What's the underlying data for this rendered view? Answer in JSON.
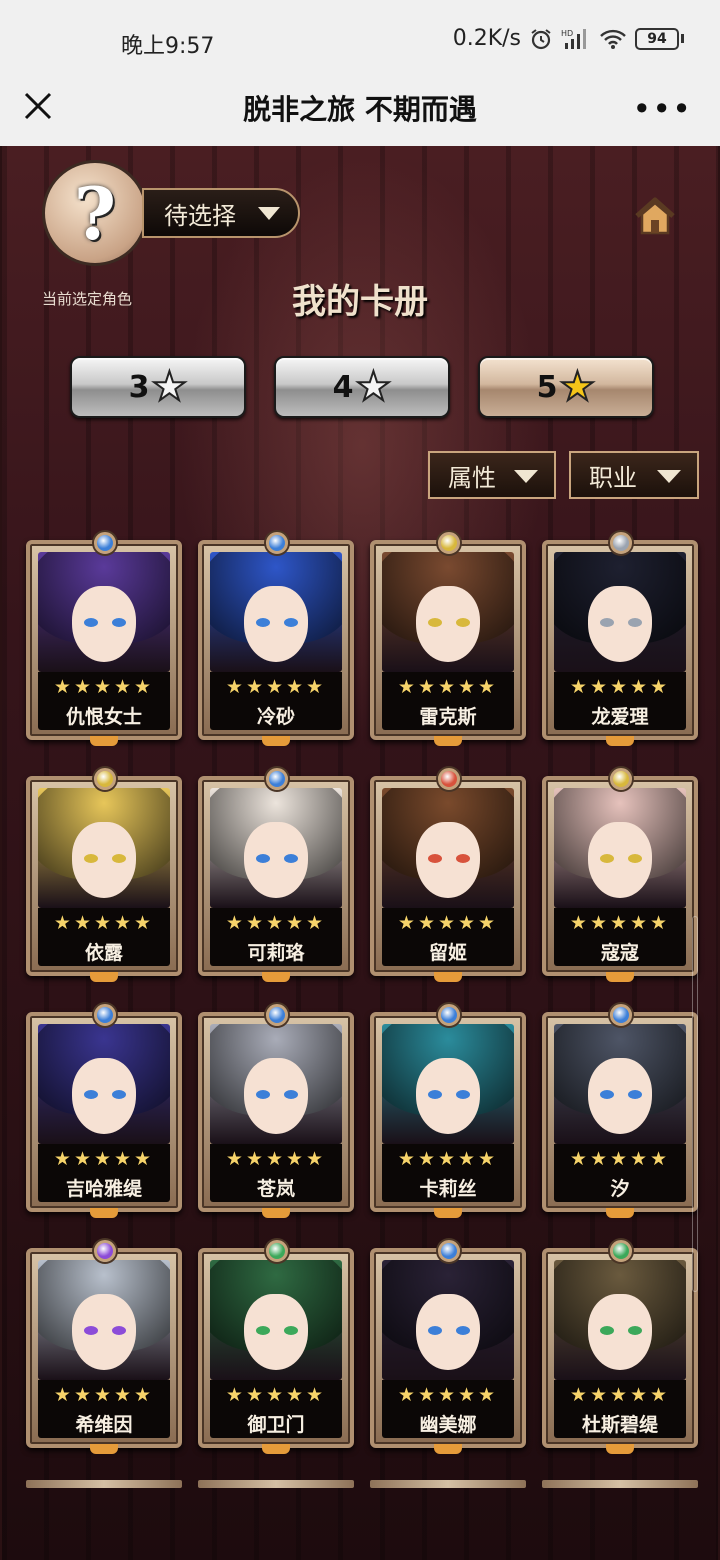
{
  "status_bar": {
    "time": "晚上9:57",
    "network_speed": "0.2K/s",
    "battery": "94"
  },
  "nav": {
    "title": "脱非之旅 不期而遇",
    "more": "•••"
  },
  "selector": {
    "avatar_symbol": "?",
    "avatar_label": "当前选定角色",
    "value": "待选择"
  },
  "page_title": "我的卡册",
  "star_tabs": [
    {
      "label": "3",
      "active": false
    },
    {
      "label": "4",
      "active": false
    },
    {
      "label": "5",
      "active": true
    }
  ],
  "filters": {
    "attribute": "属性",
    "job": "职业"
  },
  "cards": [
    {
      "name": "仇恨女士",
      "stars": "★★★★★",
      "hair": "#5a3a9a",
      "gem": "#3c7fd8"
    },
    {
      "name": "冷砂",
      "stars": "★★★★★",
      "hair": "#2e56c8",
      "gem": "#3c7fd8"
    },
    {
      "name": "雷克斯",
      "stars": "★★★★★",
      "hair": "#7a4a30",
      "gem": "#d8b83c"
    },
    {
      "name": "龙爱理",
      "stars": "★★★★★",
      "hair": "#1e2030",
      "gem": "#9aa3b0"
    },
    {
      "name": "依露",
      "stars": "★★★★★",
      "hair": "#e7c65a",
      "gem": "#d8b83c"
    },
    {
      "name": "可莉珞",
      "stars": "★★★★★",
      "hair": "#ece4dc",
      "gem": "#3c7fd8"
    },
    {
      "name": "留姬",
      "stars": "★★★★★",
      "hair": "#7a4a2c",
      "gem": "#d8523c"
    },
    {
      "name": "寇寇",
      "stars": "★★★★★",
      "hair": "#e6c2bc",
      "gem": "#d8b83c"
    },
    {
      "name": "吉哈雅缇",
      "stars": "★★★★★",
      "hair": "#3a3590",
      "gem": "#3c7fd8"
    },
    {
      "name": "苍岚",
      "stars": "★★★★★",
      "hair": "#a9acb8",
      "gem": "#3c7fd8"
    },
    {
      "name": "卡莉丝",
      "stars": "★★★★★",
      "hair": "#2b8c9c",
      "gem": "#3c7fd8"
    },
    {
      "name": "汐",
      "stars": "★★★★★",
      "hair": "#4e5566",
      "gem": "#3c7fd8"
    },
    {
      "name": "希维因",
      "stars": "★★★★★",
      "hair": "#b8c0cc",
      "gem": "#8c4cd8"
    },
    {
      "name": "御卫门",
      "stars": "★★★★★",
      "hair": "#2f6a42",
      "gem": "#3ca85a"
    },
    {
      "name": "幽美娜",
      "stars": "★★★★★",
      "hair": "#2a2236",
      "gem": "#3c7fd8"
    },
    {
      "name": "杜斯碧缇",
      "stars": "★★★★★",
      "hair": "#6a5a3e",
      "gem": "#3ca85a"
    }
  ]
}
